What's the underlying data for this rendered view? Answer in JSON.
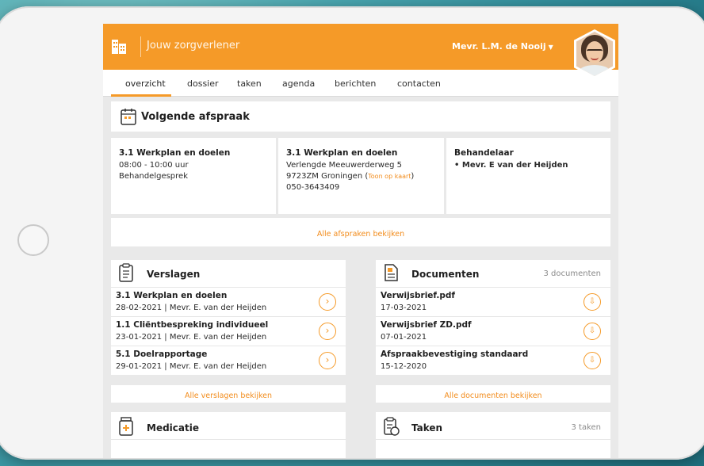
{
  "header": {
    "app_title": "Jouw zorgverlener",
    "user_name": "Mevr. L.M. de Nooij",
    "brand_color": "#f59a28"
  },
  "nav": {
    "tabs": [
      {
        "label": "overzicht",
        "active": true
      },
      {
        "label": "dossier"
      },
      {
        "label": "taken"
      },
      {
        "label": "agenda"
      },
      {
        "label": "berichten"
      },
      {
        "label": "contacten"
      }
    ]
  },
  "next_appointment": {
    "title": "Volgende afspraak",
    "col1": {
      "heading": "3.1 Werkplan en doelen",
      "time": "08:00 - 10:00 uur",
      "type": "Behandelgesprek"
    },
    "col2": {
      "heading": "3.1 Werkplan en doelen",
      "street": "Verlengde Meeuwerderweg 5",
      "city": "9723ZM Groningen (",
      "map_link": "Toon op kaart",
      "city_close": ")",
      "phone": "050-3643409"
    },
    "col3": {
      "heading": "Behandelaar",
      "practitioner": "•  Mevr. E van der Heijden"
    },
    "view_all": "Alle afspraken bekijken"
  },
  "reports": {
    "title": "Verslagen",
    "items": [
      {
        "title": "3.1 Werkplan en doelen",
        "meta": "28-02-2021  |  Mevr. E. van der Heijden"
      },
      {
        "title": "1.1 Cliëntbespreking individueel",
        "meta": "23-01-2021  | Mevr. E. van der Heijden"
      },
      {
        "title": "5.1 Doelrapportage",
        "meta": "29-01-2021  |  Mevr. E. van der Heijden"
      }
    ],
    "view_all": "Alle verslagen bekijken"
  },
  "documents": {
    "title": "Documenten",
    "count": "3 documenten",
    "items": [
      {
        "name": "Verwijsbrief.pdf",
        "date": "17-03-2021"
      },
      {
        "name": "Verwijsbrief ZD.pdf",
        "date": "07-01-2021"
      },
      {
        "name": "Afspraakbevestiging standaard",
        "date": "15-12-2020"
      }
    ],
    "view_all": "Alle documenten bekijken"
  },
  "medication": {
    "title": "Medicatie"
  },
  "tasks": {
    "title": "Taken",
    "count": "3 taken"
  }
}
